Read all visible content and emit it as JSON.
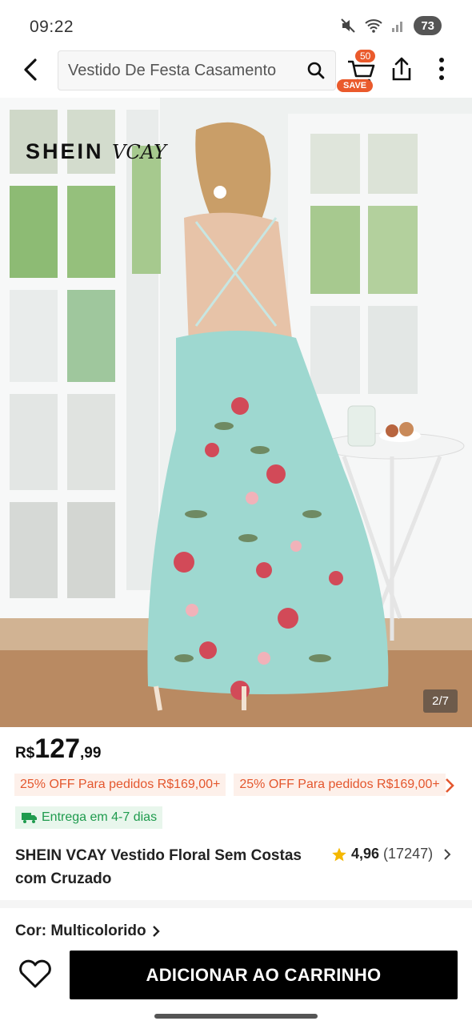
{
  "status_bar": {
    "time": "09:22",
    "battery": "73"
  },
  "search": {
    "query": "Vestido De Festa Casamento"
  },
  "cart": {
    "count": "50",
    "save_label": "SAVE"
  },
  "hero": {
    "brand": "SHEIN",
    "brand_sub": "VCAY",
    "image_counter": "2/7"
  },
  "price": {
    "currency": "R$",
    "integer": "127",
    "decimals": ",99"
  },
  "promos": [
    "25% OFF Para pedidos R$169,00+",
    "25% OFF Para pedidos R$169,00+"
  ],
  "delivery": "Entrega em 4-7 dias",
  "product": {
    "title": "SHEIN VCAY Vestido Floral Sem Costas com Cruzado",
    "rating": "4,96",
    "reviews": "(17247)"
  },
  "color": "Cor: Multicolorido",
  "actions": {
    "add_to_cart": "ADICIONAR AO CARRINHO"
  },
  "colors": {
    "accent": "#ea5a2c",
    "promo_text": "#e4572e",
    "delivery_green": "#1f9b4e",
    "button": "#000000",
    "star": "#f5b800"
  }
}
